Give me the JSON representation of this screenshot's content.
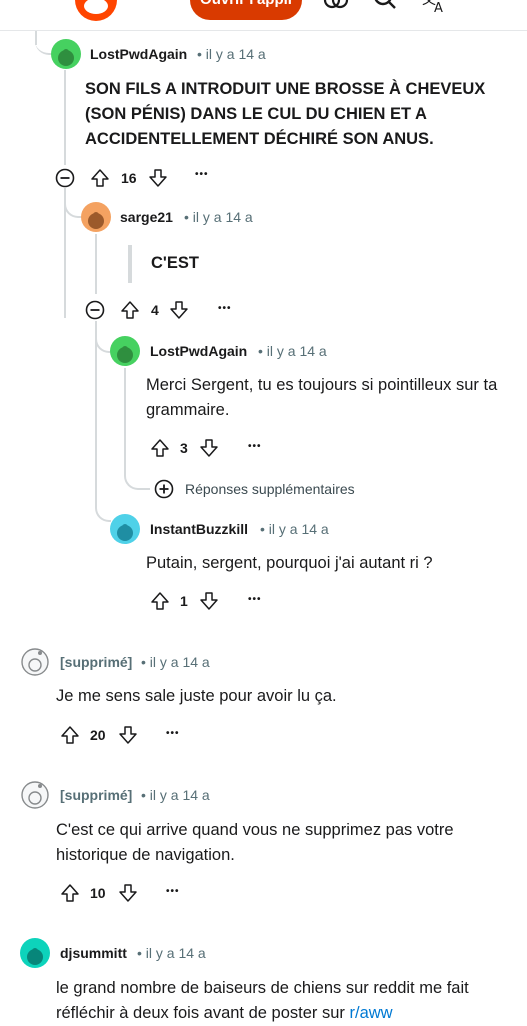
{
  "header": {
    "open_app_label": "Ouvrir l'appli"
  },
  "comments": [
    {
      "username": "LostPwdAgain",
      "time": "• il y a 14 a",
      "body": "SON FILS A INTRODUIT UNE BROSSE À CHEVEUX (SON PÉNIS) DANS LE CUL DU CHIEN ET A ACCIDENTELLEMENT DÉCHIRÉ SON ANUS.",
      "score": "16",
      "avatar_color": "#46d160"
    },
    {
      "username": "sarge21",
      "time": "• il y a 14 a",
      "body": "C'EST",
      "score": "4",
      "avatar_color": "#f4a261"
    },
    {
      "username": "LostPwdAgain",
      "time": "• il y a 14 a",
      "body": "Merci Sergent, tu es toujours si pointilleux sur ta grammaire.",
      "score": "3",
      "avatar_color": "#46d160"
    },
    {
      "more_replies_label": "Réponses supplémentaires"
    },
    {
      "username": "InstantBuzzkill",
      "time": "• il y a 14 a",
      "body": "Putain, sergent, pourquoi j'ai autant ri ?",
      "score": "1",
      "avatar_color": "#4fd1e8"
    },
    {
      "username": "[supprimé]",
      "time": "• il y a 14 a",
      "body": "Je me sens sale juste pour avoir lu ça.",
      "score": "20"
    },
    {
      "username": "[supprimé]",
      "time": "• il y a 14 a",
      "body": "C'est ce qui arrive quand vous ne supprimez pas votre historique de navigation.",
      "score": "10"
    },
    {
      "username": "djsummitt",
      "time": "• il y a 14 a",
      "body": "le grand nombre de baiseurs de chiens sur reddit me fait réfléchir à deux fois avant de poster sur ",
      "link": "r/aww",
      "avatar_color": "#0dd3bb"
    }
  ],
  "more_options": "•••",
  "colors": {
    "accent": "#d93a00",
    "meta": "#576f76",
    "thread_line": "#d6dadc",
    "link": "#0079d3"
  }
}
